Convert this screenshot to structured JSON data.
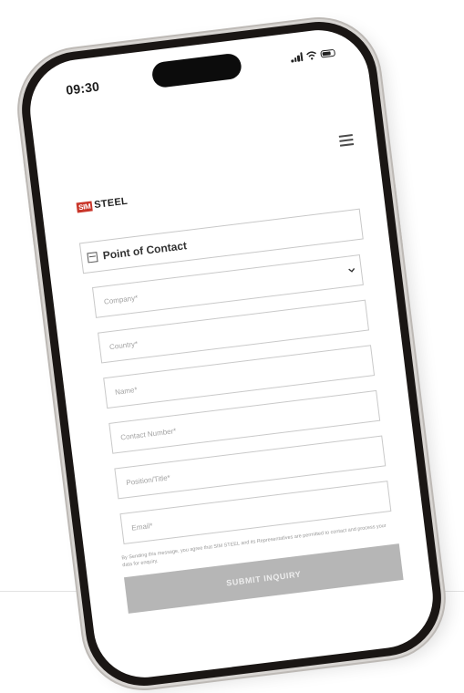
{
  "status_bar": {
    "time": "09:30"
  },
  "header": {
    "logo_mark": "SIM",
    "logo_text": "STEEL"
  },
  "form": {
    "section_title": "Point of Contact",
    "fields": [
      {
        "placeholder": "Company*",
        "type": "select"
      },
      {
        "placeholder": "Country*"
      },
      {
        "placeholder": "Name*"
      },
      {
        "placeholder": "Contact Number*"
      },
      {
        "placeholder": "Position/Title*"
      },
      {
        "placeholder": "Email*"
      }
    ],
    "legal_text": "By Sending this message, you agree that SIM STEEL and its Representatives are permitted to contact and process your data for enquiry.",
    "submit_label": "SUBMIT INQUIRY"
  }
}
